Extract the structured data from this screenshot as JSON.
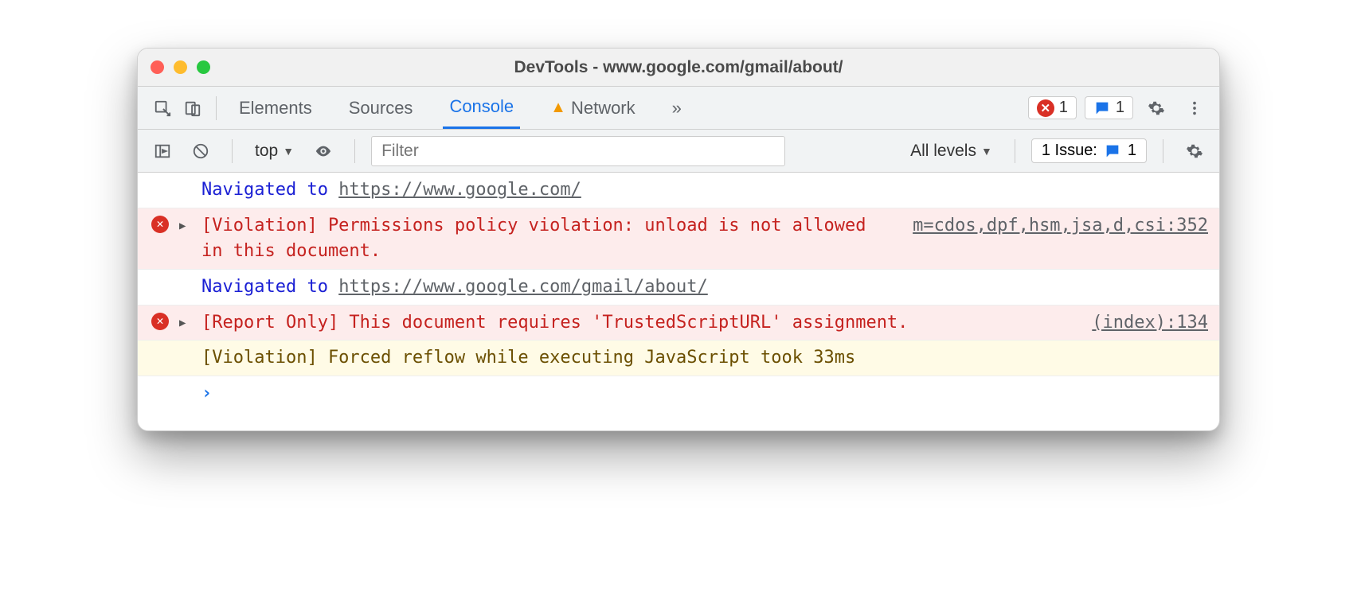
{
  "window": {
    "title": "DevTools - www.google.com/gmail/about/"
  },
  "tabs": {
    "elements": "Elements",
    "sources": "Sources",
    "console": "Console",
    "network": "Network"
  },
  "badges": {
    "errors_count": "1",
    "messages_count": "1"
  },
  "filterbar": {
    "context": "top",
    "filter_placeholder": "Filter",
    "levels": "All levels",
    "issues_label": "1 Issue:",
    "issues_count": "1"
  },
  "console": {
    "nav1_prefix": "Navigated to ",
    "nav1_url": "https://www.google.com/",
    "err1_msg": "[Violation] Permissions policy violation: unload is not allowed in this document.",
    "err1_src": "m=cdos,dpf,hsm,jsa,d,csi:352",
    "nav2_prefix": "Navigated to ",
    "nav2_url": "https://www.google.com/gmail/about/",
    "err2_msg": "[Report Only] This document requires 'TrustedScriptURL' assignment.",
    "err2_src": "(index):134",
    "warn1_msg": "[Violation] Forced reflow while executing JavaScript took 33ms"
  }
}
